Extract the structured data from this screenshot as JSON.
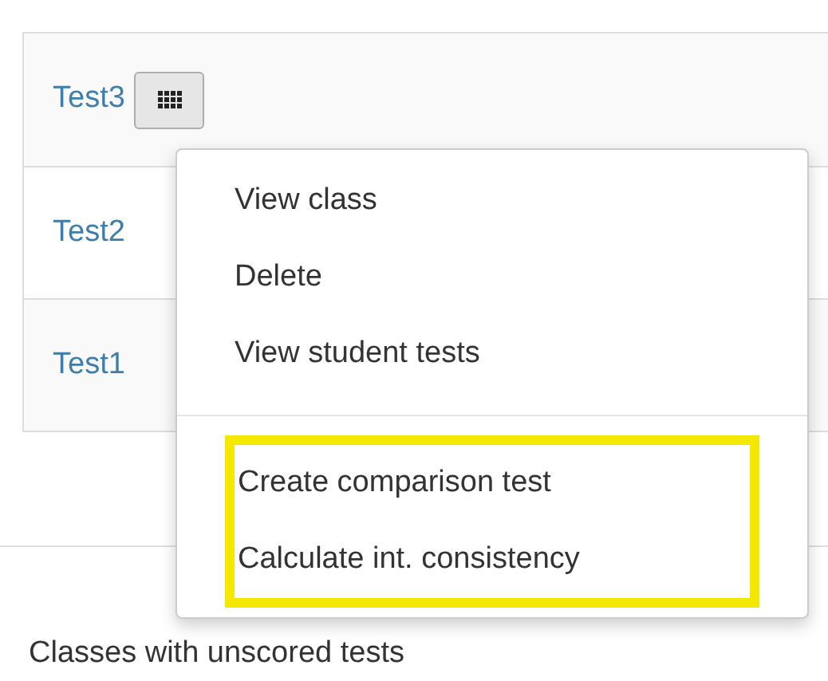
{
  "tests": [
    {
      "name": "Test3",
      "menu_button": true
    },
    {
      "name": "Test2",
      "menu_button": false
    },
    {
      "name": "Test1",
      "menu_button": false
    }
  ],
  "menu": {
    "sections": [
      {
        "highlighted": false,
        "items": [
          "View class",
          "Delete",
          "View student tests"
        ]
      },
      {
        "highlighted": true,
        "items": [
          "Create comparison test",
          "Calculate int. consistency"
        ]
      }
    ]
  },
  "section_heading": "Classes with unscored tests"
}
